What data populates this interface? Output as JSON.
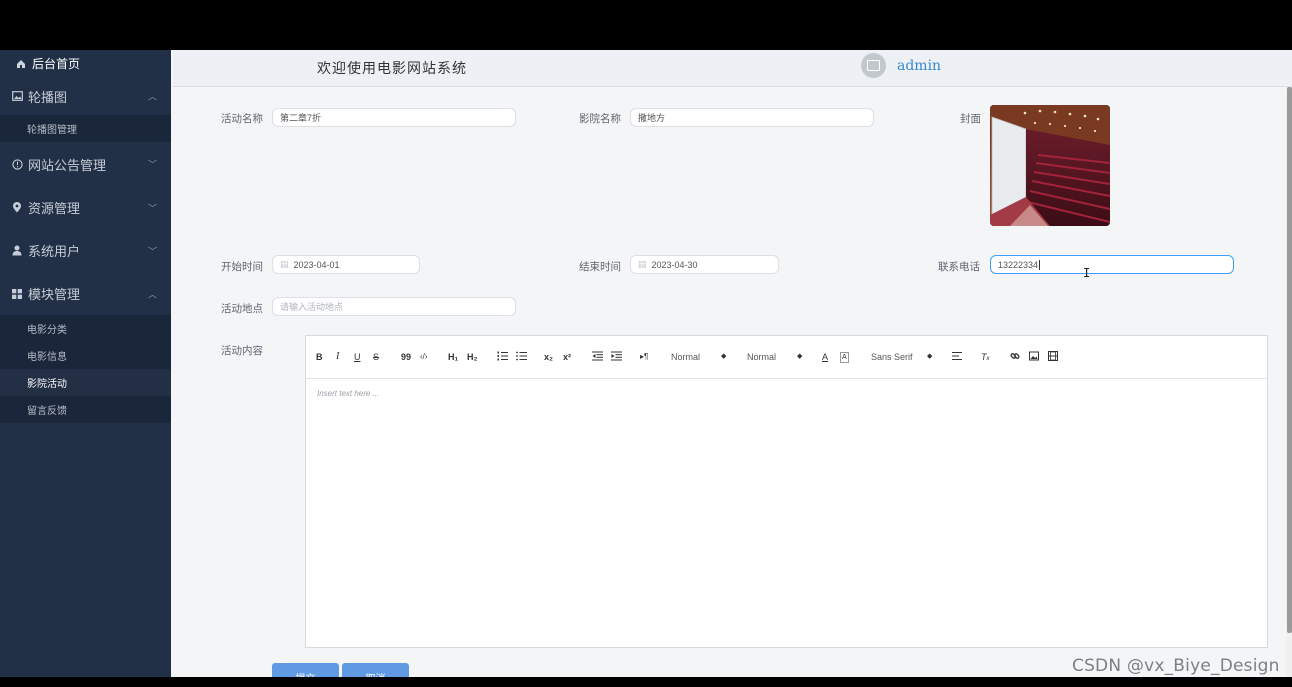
{
  "header": {
    "title": "欢迎使用电影网站系统",
    "username": "admin"
  },
  "sidebar": {
    "home": "后台首页",
    "groups": [
      {
        "label": "轮播图",
        "icon": "image-icon",
        "expanded": true,
        "items": [
          "轮播图管理"
        ]
      },
      {
        "label": "网站公告管理",
        "icon": "info-icon",
        "expanded": false,
        "items": []
      },
      {
        "label": "资源管理",
        "icon": "location-icon",
        "expanded": false,
        "items": []
      },
      {
        "label": "系统用户",
        "icon": "user-icon",
        "expanded": false,
        "items": []
      },
      {
        "label": "模块管理",
        "icon": "grid-icon",
        "expanded": true,
        "items": [
          "电影分类",
          "电影信息",
          "影院活动",
          "留言反馈"
        ]
      }
    ],
    "active_item": "影院活动"
  },
  "form": {
    "activity_name_label": "活动名称",
    "activity_name_value": "第二章7折",
    "cinema_name_label": "影院名称",
    "cinema_name_value": "撒地方",
    "cover_label": "封面",
    "start_time_label": "开始时间",
    "start_time_value": "2023-04-01",
    "end_time_label": "结束时间",
    "end_time_value": "2023-04-30",
    "phone_label": "联系电话",
    "phone_value": "13222334",
    "location_label": "活动地点",
    "location_placeholder": "请输入活动地点",
    "content_label": "活动内容"
  },
  "editor": {
    "toolbar": {
      "bold": "B",
      "italic": "I",
      "underline": "U",
      "strike": "S",
      "blockquote": "99",
      "code": "‹/›",
      "h1": "H₁",
      "h2": "H₂",
      "subscript": "x₂",
      "superscript": "x²",
      "direction": "▸¶",
      "size_select": "Normal",
      "header_select": "Normal",
      "font_select": "Sans Serif"
    },
    "placeholder": "Insert text here ..."
  },
  "buttons": {
    "submit": "提交",
    "cancel": "取消"
  },
  "watermark": "CSDN @vx_Biye_Design"
}
